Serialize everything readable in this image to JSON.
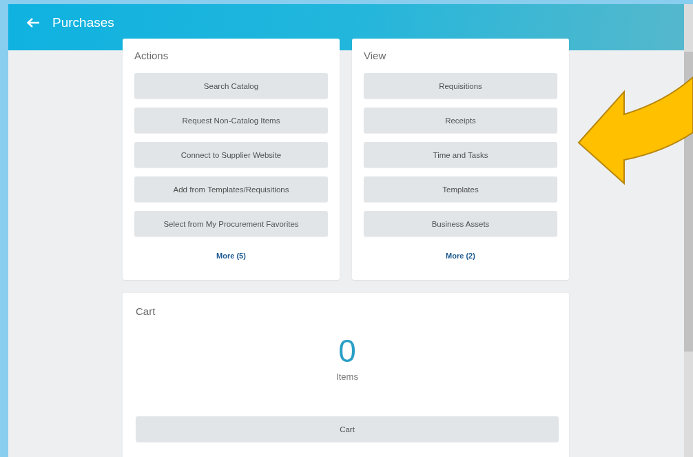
{
  "header": {
    "title": "Purchases"
  },
  "cards": [
    {
      "title": "Actions",
      "buttons": [
        "Search Catalog",
        "Request Non-Catalog Items",
        "Connect to Supplier Website",
        "Add from Templates/Requisitions",
        "Select from My Procurement Favorites"
      ],
      "more": "More (5)"
    },
    {
      "title": "View",
      "buttons": [
        "Requisitions",
        "Receipts",
        "Time and Tasks",
        "Templates",
        "Business Assets"
      ],
      "more": "More (2)"
    }
  ],
  "cart": {
    "title": "Cart",
    "count": "0",
    "count_label": "Items",
    "button": "Cart"
  }
}
